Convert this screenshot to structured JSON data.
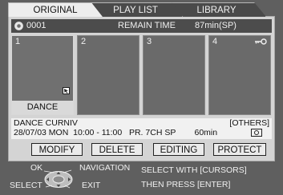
{
  "tabs": [
    {
      "label": "ORIGINAL",
      "active": true
    },
    {
      "label": "PLAY LIST",
      "active": false
    },
    {
      "label": "LIBRARY",
      "active": false
    }
  ],
  "infobar": {
    "disc_icon": "disc-icon",
    "disc_number": "0001",
    "remain_label": "REMAIN TIME",
    "remain_value": "87min(SP)"
  },
  "thumbnails": [
    {
      "number": "1",
      "title": "DANCE",
      "selected": true
    },
    {
      "number": "2"
    },
    {
      "number": "3"
    },
    {
      "number": "4",
      "protected": true,
      "icon": "key-icon"
    }
  ],
  "details": {
    "title": "DANCE CURNIV",
    "line": "28/07/03 MON  10:00 - 11:00   PR. 7CH SP        60min",
    "category": "[OTHERS]",
    "icon": "disc-type-icon"
  },
  "buttons": {
    "modify": "MODIFY",
    "delete": "DELETE",
    "editing": "EDITING",
    "protect": "PROTECT"
  },
  "help": {
    "ok": "OK",
    "navigation": "NAVIGATION",
    "select": "SELECT",
    "exit": "EXIT",
    "instruction_1": "SELECT WITH [CURSORS]",
    "instruction_2": "THEN PRESS [ENTER]"
  },
  "colors": {
    "background": "#5f5f5f",
    "panel": "#d4d4d4",
    "active_tab": "#ededed",
    "thumbnail": "#6a6a6a"
  }
}
